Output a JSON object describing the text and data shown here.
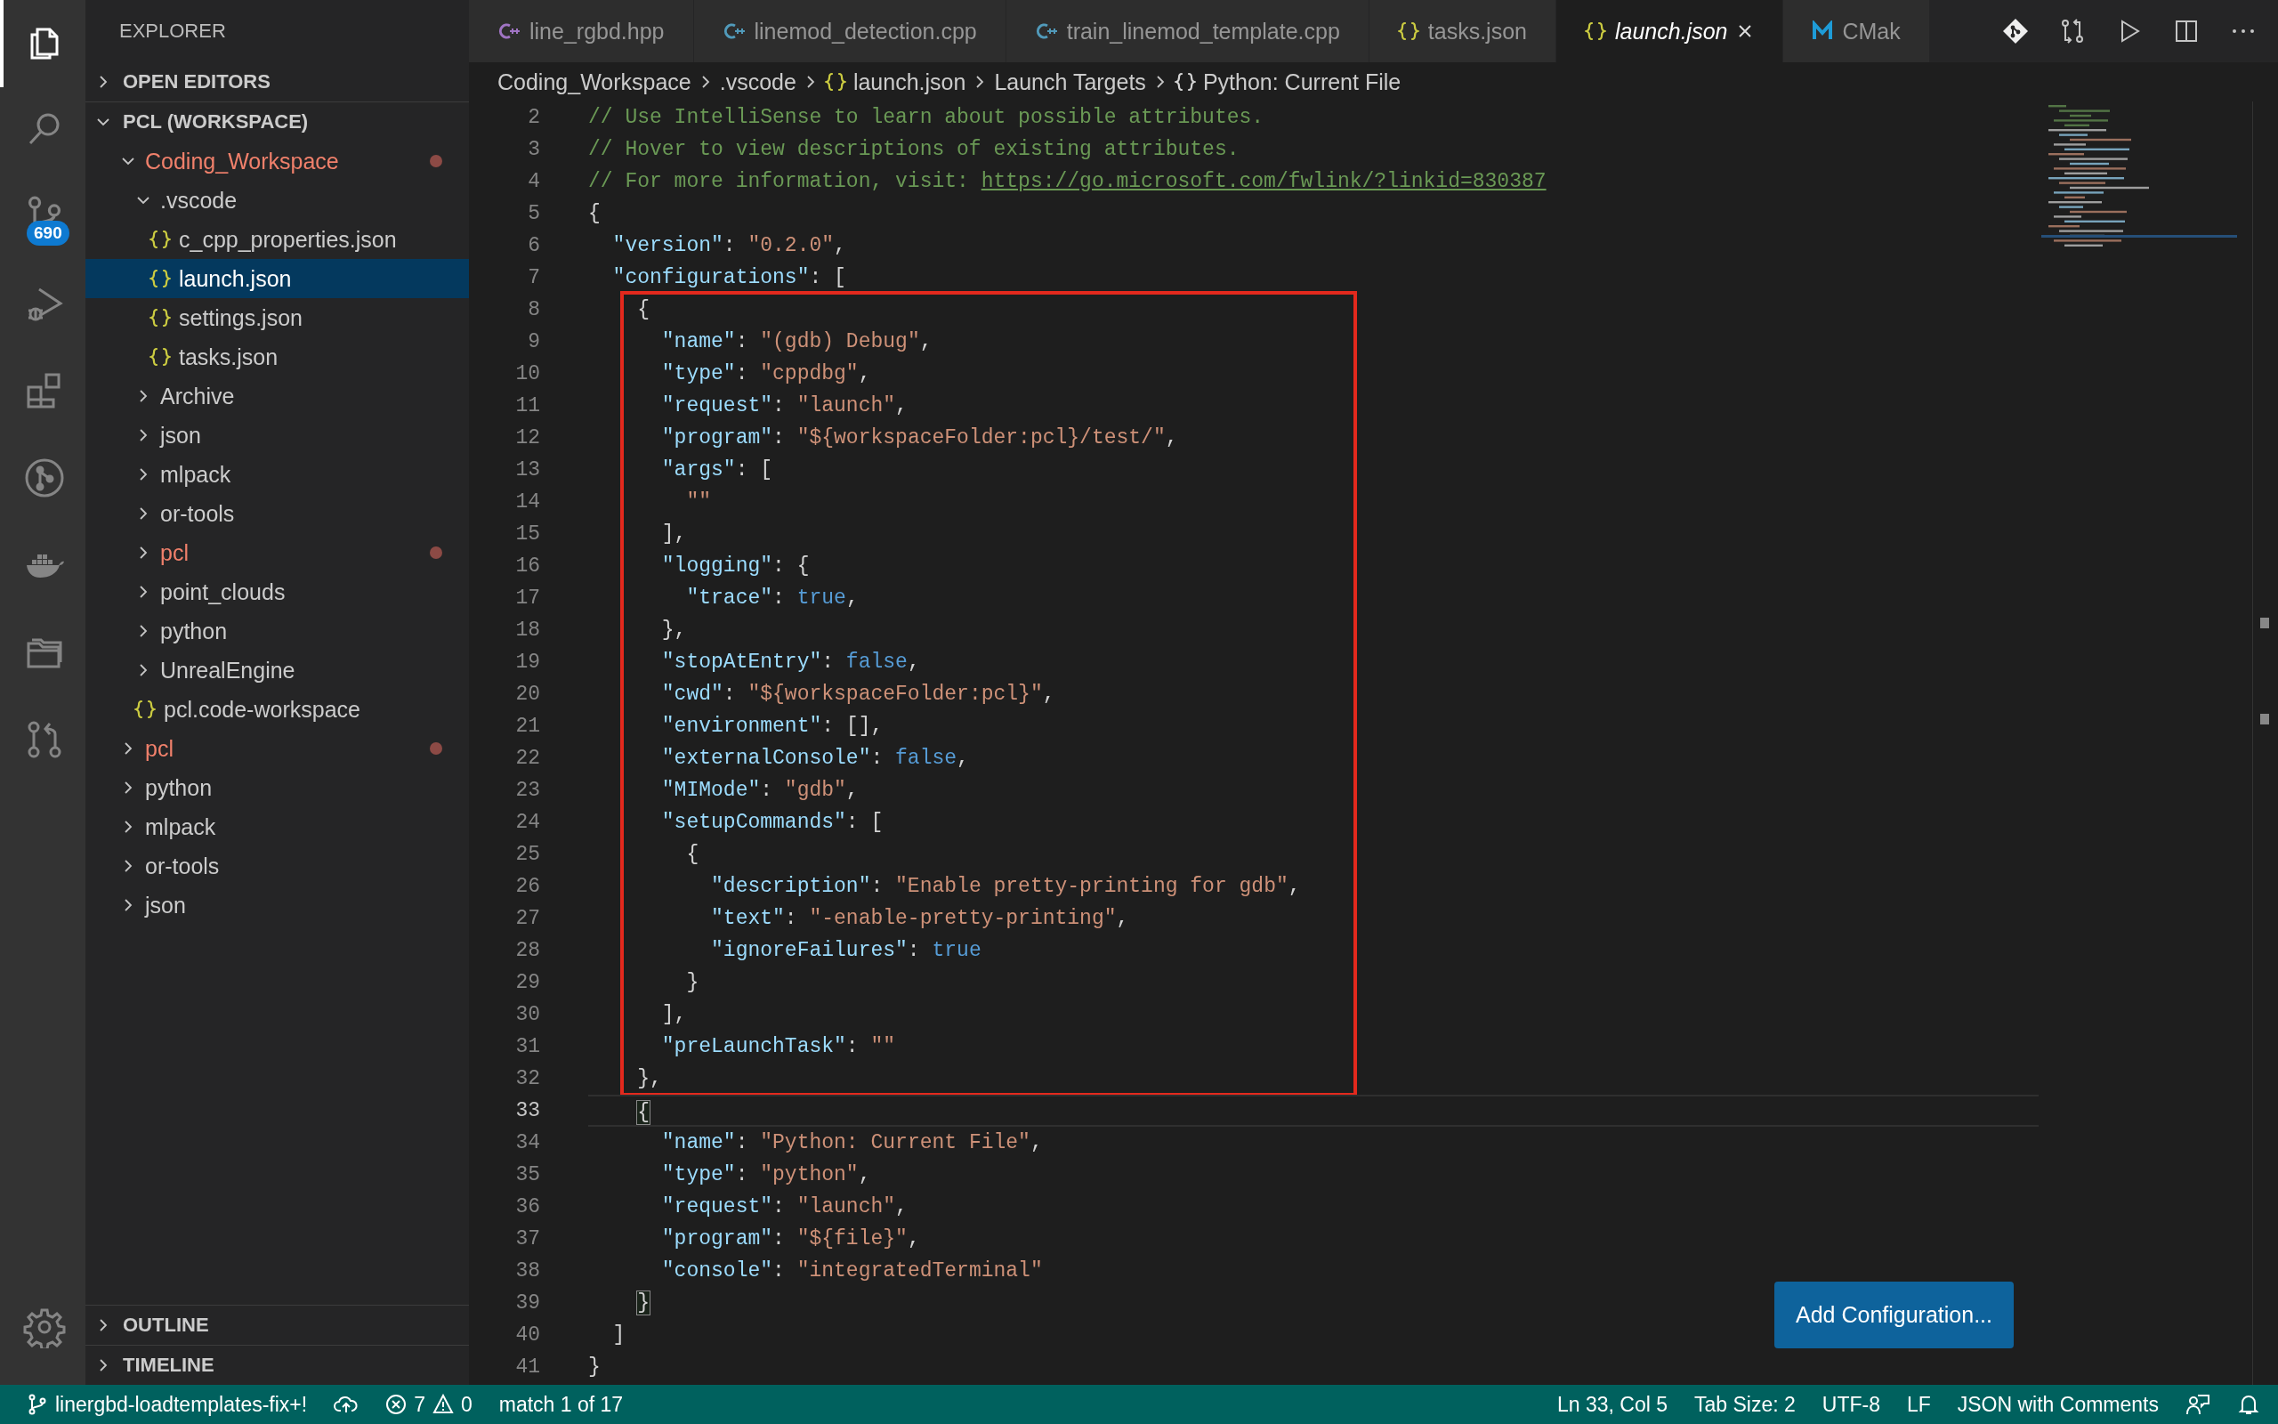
{
  "activity_bar": {
    "items": [
      {
        "kind": "files",
        "selected": true
      },
      {
        "kind": "search",
        "selected": false
      },
      {
        "kind": "source-control",
        "selected": false,
        "badge": "690"
      },
      {
        "kind": "run-debug",
        "selected": false
      },
      {
        "kind": "extensions",
        "selected": false
      },
      {
        "kind": "git-graph",
        "selected": false
      },
      {
        "kind": "docker",
        "selected": false
      },
      {
        "kind": "folders",
        "selected": false
      },
      {
        "kind": "pull-request",
        "selected": false
      }
    ],
    "bottom": [
      {
        "kind": "settings",
        "selected": false
      }
    ]
  },
  "sidebar": {
    "title": "EXPLORER",
    "open_editors": {
      "label": "OPEN EDITORS",
      "expanded": false
    },
    "workspace": {
      "label": "PCL (WORKSPACE)",
      "expanded": true,
      "items": [
        {
          "label": "Coding_Workspace",
          "kind": "folder",
          "expanded": true,
          "modified": true,
          "selected": false,
          "children": [
            {
              "label": ".vscode",
              "kind": "folder",
              "expanded": true,
              "modified": false,
              "selected": false,
              "children": [
                {
                  "label": "c_cpp_properties.json",
                  "kind": "file",
                  "modified": false,
                  "selected": false
                },
                {
                  "label": "launch.json",
                  "kind": "file",
                  "modified": false,
                  "selected": true
                },
                {
                  "label": "settings.json",
                  "kind": "file",
                  "modified": false,
                  "selected": false
                },
                {
                  "label": "tasks.json",
                  "kind": "file",
                  "modified": false,
                  "selected": false
                }
              ]
            },
            {
              "label": "Archive",
              "kind": "folder",
              "expanded": false,
              "modified": false,
              "selected": false
            },
            {
              "label": "json",
              "kind": "folder",
              "expanded": false,
              "modified": false,
              "selected": false
            },
            {
              "label": "mlpack",
              "kind": "folder",
              "expanded": false,
              "modified": false,
              "selected": false
            },
            {
              "label": "or-tools",
              "kind": "folder",
              "expanded": false,
              "modified": false,
              "selected": false
            },
            {
              "label": "pcl",
              "kind": "folder",
              "expanded": false,
              "modified": true,
              "selected": false
            },
            {
              "label": "point_clouds",
              "kind": "folder",
              "expanded": false,
              "modified": false,
              "selected": false
            },
            {
              "label": "python",
              "kind": "folder",
              "expanded": false,
              "modified": false,
              "selected": false
            },
            {
              "label": "UnrealEngine",
              "kind": "folder",
              "expanded": false,
              "modified": false,
              "selected": false
            },
            {
              "label": "pcl.code-workspace",
              "kind": "file",
              "modified": false,
              "selected": false
            }
          ]
        },
        {
          "label": "pcl",
          "kind": "folder",
          "expanded": false,
          "modified": true,
          "selected": false
        },
        {
          "label": "python",
          "kind": "folder",
          "expanded": false,
          "modified": false,
          "selected": false
        },
        {
          "label": "mlpack",
          "kind": "folder",
          "expanded": false,
          "modified": false,
          "selected": false
        },
        {
          "label": "or-tools",
          "kind": "folder",
          "expanded": false,
          "modified": false,
          "selected": false
        },
        {
          "label": "json",
          "kind": "folder",
          "expanded": false,
          "modified": false,
          "selected": false
        }
      ]
    },
    "bottom_sections": [
      {
        "label": "OUTLINE",
        "expanded": false
      },
      {
        "label": "TIMELINE",
        "expanded": false
      }
    ]
  },
  "tabs": [
    {
      "label": "line_rgbd.hpp",
      "kind": "cpp-header",
      "selected": false,
      "preview": false
    },
    {
      "label": "linemod_detection.cpp",
      "kind": "cpp",
      "selected": false,
      "preview": false
    },
    {
      "label": "train_linemod_template.cpp",
      "kind": "cpp",
      "selected": false,
      "preview": false
    },
    {
      "label": "tasks.json",
      "kind": "json",
      "selected": false,
      "preview": false
    },
    {
      "label": "launch.json",
      "kind": "json",
      "selected": true,
      "preview": true
    },
    {
      "label": "CMak",
      "kind": "cmake",
      "selected": false,
      "preview": false
    }
  ],
  "editor_actions": [
    {
      "kind": "git-diamond"
    },
    {
      "kind": "compare"
    },
    {
      "kind": "run"
    },
    {
      "kind": "split"
    },
    {
      "kind": "more"
    }
  ],
  "breadcrumbs": [
    {
      "label": "Coding_Workspace",
      "kind": "folder"
    },
    {
      "label": ".vscode",
      "kind": "folder"
    },
    {
      "label": "launch.json",
      "kind": "file"
    },
    {
      "label": "Launch Targets",
      "kind": "section"
    },
    {
      "label": "Python: Current File",
      "kind": "symbol"
    }
  ],
  "code": {
    "lines": [
      {
        "number": "2",
        "boxed": false,
        "current": false,
        "tokens": [
          {
            "kind": "comment",
            "text": "// Use IntelliSense to learn about possible attributes."
          }
        ]
      },
      {
        "number": "3",
        "boxed": false,
        "current": false,
        "tokens": [
          {
            "kind": "comment",
            "text": "// Hover to view descriptions of existing attributes."
          }
        ]
      },
      {
        "number": "4",
        "boxed": false,
        "current": false,
        "tokens": [
          {
            "kind": "comment",
            "text": "// For more information, visit: "
          },
          {
            "kind": "link",
            "text": "https://go.microsoft.com/fwlink/?linkid=830387"
          }
        ]
      },
      {
        "number": "5",
        "boxed": false,
        "current": false,
        "tokens": [
          {
            "kind": "punct",
            "text": "{"
          }
        ]
      },
      {
        "number": "6",
        "boxed": false,
        "current": false,
        "tokens": [
          {
            "kind": "key",
            "text": "  \"version\""
          },
          {
            "kind": "punct",
            "text": ": "
          },
          {
            "kind": "string",
            "text": "\"0.2.0\""
          },
          {
            "kind": "punct",
            "text": ","
          }
        ]
      },
      {
        "number": "7",
        "boxed": false,
        "current": false,
        "tokens": [
          {
            "kind": "key",
            "text": "  \"configurations\""
          },
          {
            "kind": "punct",
            "text": ": ["
          }
        ]
      },
      {
        "number": "8",
        "boxed": true,
        "current": false,
        "tokens": [
          {
            "kind": "punct",
            "text": "    {"
          }
        ]
      },
      {
        "number": "9",
        "boxed": true,
        "current": false,
        "tokens": [
          {
            "kind": "key",
            "text": "      \"name\""
          },
          {
            "kind": "punct",
            "text": ": "
          },
          {
            "kind": "string",
            "text": "\"(gdb) Debug\""
          },
          {
            "kind": "punct",
            "text": ","
          }
        ]
      },
      {
        "number": "10",
        "boxed": true,
        "current": false,
        "tokens": [
          {
            "kind": "key",
            "text": "      \"type\""
          },
          {
            "kind": "punct",
            "text": ": "
          },
          {
            "kind": "string",
            "text": "\"cppdbg\""
          },
          {
            "kind": "punct",
            "text": ","
          }
        ]
      },
      {
        "number": "11",
        "boxed": true,
        "current": false,
        "tokens": [
          {
            "kind": "key",
            "text": "      \"request\""
          },
          {
            "kind": "punct",
            "text": ": "
          },
          {
            "kind": "string",
            "text": "\"launch\""
          },
          {
            "kind": "punct",
            "text": ","
          }
        ]
      },
      {
        "number": "12",
        "boxed": true,
        "current": false,
        "tokens": [
          {
            "kind": "key",
            "text": "      \"program\""
          },
          {
            "kind": "punct",
            "text": ": "
          },
          {
            "kind": "string",
            "text": "\"${workspaceFolder:pcl}/test/\""
          },
          {
            "kind": "punct",
            "text": ","
          }
        ]
      },
      {
        "number": "13",
        "boxed": true,
        "current": false,
        "tokens": [
          {
            "kind": "key",
            "text": "      \"args\""
          },
          {
            "kind": "punct",
            "text": ": ["
          }
        ]
      },
      {
        "number": "14",
        "boxed": true,
        "current": false,
        "tokens": [
          {
            "kind": "string",
            "text": "        \"\""
          }
        ]
      },
      {
        "number": "15",
        "boxed": true,
        "current": false,
        "tokens": [
          {
            "kind": "punct",
            "text": "      ],"
          }
        ]
      },
      {
        "number": "16",
        "boxed": true,
        "current": false,
        "tokens": [
          {
            "kind": "key",
            "text": "      \"logging\""
          },
          {
            "kind": "punct",
            "text": ": {"
          }
        ]
      },
      {
        "number": "17",
        "boxed": true,
        "current": false,
        "tokens": [
          {
            "kind": "key",
            "text": "        \"trace\""
          },
          {
            "kind": "punct",
            "text": ": "
          },
          {
            "kind": "bool",
            "text": "true"
          },
          {
            "kind": "punct",
            "text": ","
          }
        ]
      },
      {
        "number": "18",
        "boxed": true,
        "current": false,
        "tokens": [
          {
            "kind": "punct",
            "text": "      },"
          }
        ]
      },
      {
        "number": "19",
        "boxed": true,
        "current": false,
        "tokens": [
          {
            "kind": "key",
            "text": "      \"stopAtEntry\""
          },
          {
            "kind": "punct",
            "text": ": "
          },
          {
            "kind": "bool",
            "text": "false"
          },
          {
            "kind": "punct",
            "text": ","
          }
        ]
      },
      {
        "number": "20",
        "boxed": true,
        "current": false,
        "tokens": [
          {
            "kind": "key",
            "text": "      \"cwd\""
          },
          {
            "kind": "punct",
            "text": ": "
          },
          {
            "kind": "string",
            "text": "\"${workspaceFolder:pcl}\""
          },
          {
            "kind": "punct",
            "text": ","
          }
        ]
      },
      {
        "number": "21",
        "boxed": true,
        "current": false,
        "tokens": [
          {
            "kind": "key",
            "text": "      \"environment\""
          },
          {
            "kind": "punct",
            "text": ": [],"
          }
        ]
      },
      {
        "number": "22",
        "boxed": true,
        "current": false,
        "tokens": [
          {
            "kind": "key",
            "text": "      \"externalConsole\""
          },
          {
            "kind": "punct",
            "text": ": "
          },
          {
            "kind": "bool",
            "text": "false"
          },
          {
            "kind": "punct",
            "text": ","
          }
        ]
      },
      {
        "number": "23",
        "boxed": true,
        "current": false,
        "tokens": [
          {
            "kind": "key",
            "text": "      \"MIMode\""
          },
          {
            "kind": "punct",
            "text": ": "
          },
          {
            "kind": "string",
            "text": "\"gdb\""
          },
          {
            "kind": "punct",
            "text": ","
          }
        ]
      },
      {
        "number": "24",
        "boxed": true,
        "current": false,
        "tokens": [
          {
            "kind": "key",
            "text": "      \"setupCommands\""
          },
          {
            "kind": "punct",
            "text": ": ["
          }
        ]
      },
      {
        "number": "25",
        "boxed": true,
        "current": false,
        "tokens": [
          {
            "kind": "punct",
            "text": "        {"
          }
        ]
      },
      {
        "number": "26",
        "boxed": true,
        "current": false,
        "tokens": [
          {
            "kind": "key",
            "text": "          \"description\""
          },
          {
            "kind": "punct",
            "text": ": "
          },
          {
            "kind": "string",
            "text": "\"Enable pretty-printing for gdb\""
          },
          {
            "kind": "punct",
            "text": ","
          }
        ]
      },
      {
        "number": "27",
        "boxed": true,
        "current": false,
        "tokens": [
          {
            "kind": "key",
            "text": "          \"text\""
          },
          {
            "kind": "punct",
            "text": ": "
          },
          {
            "kind": "string",
            "text": "\"-enable-pretty-printing\""
          },
          {
            "kind": "punct",
            "text": ","
          }
        ]
      },
      {
        "number": "28",
        "boxed": true,
        "current": false,
        "tokens": [
          {
            "kind": "key",
            "text": "          \"ignoreFailures\""
          },
          {
            "kind": "punct",
            "text": ": "
          },
          {
            "kind": "bool",
            "text": "true"
          }
        ]
      },
      {
        "number": "29",
        "boxed": true,
        "current": false,
        "tokens": [
          {
            "kind": "punct",
            "text": "        }"
          }
        ]
      },
      {
        "number": "30",
        "boxed": true,
        "current": false,
        "tokens": [
          {
            "kind": "punct",
            "text": "      ],"
          }
        ]
      },
      {
        "number": "31",
        "boxed": true,
        "current": false,
        "tokens": [
          {
            "kind": "key",
            "text": "      \"preLaunchTask\""
          },
          {
            "kind": "punct",
            "text": ": "
          },
          {
            "kind": "string",
            "text": "\"\""
          }
        ]
      },
      {
        "number": "32",
        "boxed": true,
        "current": false,
        "tokens": [
          {
            "kind": "punct",
            "text": "    },"
          }
        ]
      },
      {
        "number": "33",
        "boxed": false,
        "current": true,
        "tokens": [
          {
            "kind": "matched-bracket",
            "text": "    {"
          }
        ]
      },
      {
        "number": "34",
        "boxed": false,
        "current": false,
        "tokens": [
          {
            "kind": "key",
            "text": "      \"name\""
          },
          {
            "kind": "punct",
            "text": ": "
          },
          {
            "kind": "string",
            "text": "\"Python: Current File\""
          },
          {
            "kind": "punct",
            "text": ","
          }
        ]
      },
      {
        "number": "35",
        "boxed": false,
        "current": false,
        "tokens": [
          {
            "kind": "key",
            "text": "      \"type\""
          },
          {
            "kind": "punct",
            "text": ": "
          },
          {
            "kind": "string",
            "text": "\"python\""
          },
          {
            "kind": "punct",
            "text": ","
          }
        ]
      },
      {
        "number": "36",
        "boxed": false,
        "current": false,
        "tokens": [
          {
            "kind": "key",
            "text": "      \"request\""
          },
          {
            "kind": "punct",
            "text": ": "
          },
          {
            "kind": "string",
            "text": "\"launch\""
          },
          {
            "kind": "punct",
            "text": ","
          }
        ]
      },
      {
        "number": "37",
        "boxed": false,
        "current": false,
        "tokens": [
          {
            "kind": "key",
            "text": "      \"program\""
          },
          {
            "kind": "punct",
            "text": ": "
          },
          {
            "kind": "string",
            "text": "\"${file}\""
          },
          {
            "kind": "punct",
            "text": ","
          }
        ]
      },
      {
        "number": "38",
        "boxed": false,
        "current": false,
        "tokens": [
          {
            "kind": "key",
            "text": "      \"console\""
          },
          {
            "kind": "punct",
            "text": ": "
          },
          {
            "kind": "string",
            "text": "\"integratedTerminal\""
          }
        ]
      },
      {
        "number": "39",
        "boxed": false,
        "current": false,
        "tokens": [
          {
            "kind": "matched-bracket",
            "text": "    }"
          }
        ]
      },
      {
        "number": "40",
        "boxed": false,
        "current": false,
        "tokens": [
          {
            "kind": "punct",
            "text": "  ]"
          }
        ]
      },
      {
        "number": "41",
        "boxed": false,
        "current": false,
        "tokens": [
          {
            "kind": "punct",
            "text": "}"
          }
        ]
      }
    ],
    "add_button": "Add Configuration..."
  },
  "status_bar": {
    "left": [
      {
        "kind": "branch",
        "text": "linergbd-loadtemplates-fix+!"
      },
      {
        "kind": "sync"
      },
      {
        "kind": "problems",
        "errors": "7",
        "warnings": "0"
      },
      {
        "kind": "text",
        "text": "match 1 of 17"
      }
    ],
    "right": [
      {
        "kind": "text",
        "text": "Ln 33, Col 5"
      },
      {
        "kind": "text",
        "text": "Tab Size: 2"
      },
      {
        "kind": "text",
        "text": "UTF-8"
      },
      {
        "kind": "text",
        "text": "LF"
      },
      {
        "kind": "text",
        "text": "JSON with Comments"
      },
      {
        "kind": "feedback"
      },
      {
        "kind": "bell"
      }
    ]
  }
}
